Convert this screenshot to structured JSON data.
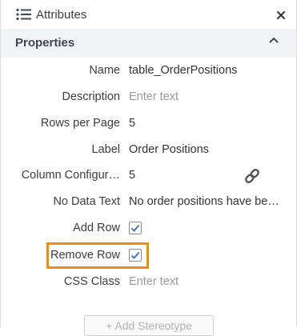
{
  "header": {
    "icon": "list-icon",
    "title": "Attributes",
    "close_icon": "close-icon"
  },
  "section": {
    "title": "Properties",
    "collapse_icon": "chevron-up-icon"
  },
  "properties": [
    {
      "label": "Name",
      "value": "table_OrderPositions"
    },
    {
      "label": "Description",
      "placeholder": "Enter text"
    },
    {
      "label": "Rows per Page",
      "value": "5"
    },
    {
      "label": "Label",
      "value": "Order Positions"
    },
    {
      "label": "Column Configur…",
      "value": "5",
      "action_icon": "link-icon"
    },
    {
      "label": "No Data Text",
      "value": "No order positions have be…"
    },
    {
      "label": "Add Row",
      "checked": true
    },
    {
      "label": "Remove Row",
      "checked": true,
      "highlighted": true
    },
    {
      "label": "CSS Class",
      "placeholder": "Enter text"
    }
  ],
  "footer": {
    "add_stereotype_label": "+ Add Stereotype"
  },
  "colors": {
    "highlight": "#f28c00",
    "check": "#2f6fbf",
    "section_bg": "#f2f3f5"
  }
}
